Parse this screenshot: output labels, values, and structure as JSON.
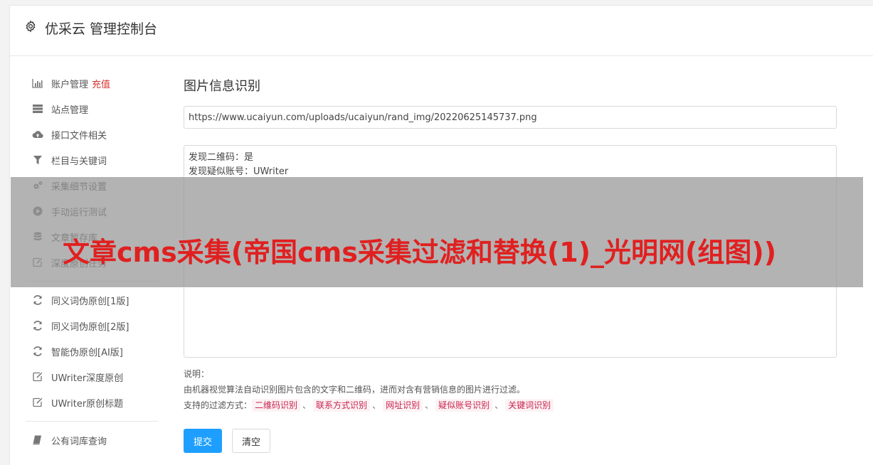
{
  "header": {
    "title": "优采云 管理控制台"
  },
  "sidebar": {
    "group1": [
      {
        "label": "账户管理",
        "badge": "充值",
        "icon": "bar-chart-icon"
      },
      {
        "label": "站点管理",
        "icon": "server-icon"
      },
      {
        "label": "接口文件相关",
        "icon": "cloud-upload-icon"
      },
      {
        "label": "栏目与关键词",
        "icon": "filter-icon"
      },
      {
        "label": "采集细节设置",
        "icon": "gears-icon"
      },
      {
        "label": "手动运行测试",
        "icon": "play-circle-icon"
      },
      {
        "label": "文章暂存库",
        "icon": "database-icon"
      },
      {
        "label": "深度原创任务",
        "icon": "edit-icon"
      }
    ],
    "group2": [
      {
        "label": "同义词伪原创[1版]",
        "icon": "refresh-icon"
      },
      {
        "label": "同义词伪原创[2版]",
        "icon": "refresh-icon"
      },
      {
        "label": "智能伪原创[AI版]",
        "icon": "refresh-icon"
      },
      {
        "label": "UWriter深度原创",
        "icon": "edit-icon"
      },
      {
        "label": "UWriter原创标题",
        "icon": "edit-icon"
      }
    ],
    "group3": [
      {
        "label": "公有词库查询",
        "icon": "book-icon"
      }
    ]
  },
  "main": {
    "section_title": "图片信息识别",
    "url_value": "https://www.ucaiyun.com/uploads/ucaiyun/rand_img/20220625145737.png",
    "result_lines": [
      "发现二维码：是",
      "发现疑似账号：UWriter"
    ],
    "desc_label": "说明：",
    "desc_text": "由机器视觉算法自动识别图片包含的文字和二维码，进而对含有营销信息的图片进行过滤。",
    "filter_prefix": "支持的过滤方式：",
    "filter_tags": [
      "二维码识别",
      "联系方式识别",
      "网址识别",
      "疑似账号识别",
      "关键词识别"
    ],
    "filter_sep": "、",
    "submit_label": "提交",
    "clear_label": "清空"
  },
  "overlay": {
    "title": "文章cms采集(帝国cms采集过滤和替换(1)_光明网(组图))"
  },
  "colors": {
    "accent": "#1e9fff",
    "badge": "#d6332f",
    "tag_text": "#c7254e",
    "overlay_title": "#e02020"
  }
}
